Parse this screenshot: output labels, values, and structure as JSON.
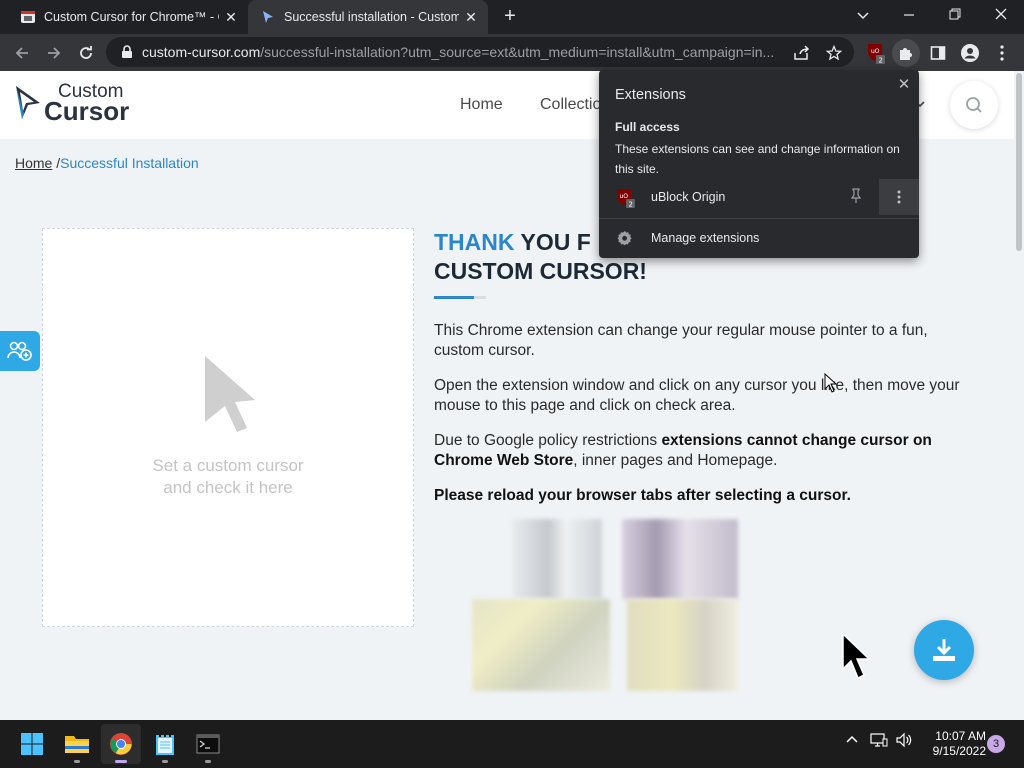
{
  "browser": {
    "tabs": [
      {
        "title": "Custom Cursor for Chrome™ - Ch",
        "active": false
      },
      {
        "title": "Successful installation - Custom C",
        "active": true
      }
    ],
    "url_host": "custom-cursor.com",
    "url_path": "/successful-installation?utm_source=ext&utm_medium=install&utm_campaign=in...",
    "extension_badge": "2"
  },
  "site": {
    "logo_line1": "Custom",
    "logo_line2": "Cursor",
    "nav": {
      "home": "Home",
      "collections": "Collectio"
    },
    "breadcrumb": {
      "home": "Home",
      "sep": "/",
      "current": "Successful Installation"
    }
  },
  "main": {
    "check_area_hint_1": "Set a custom cursor",
    "check_area_hint_2": "and check it here",
    "heading_blue": "THANK",
    "heading_rest": " YOU F",
    "heading_line2": "CUSTOM CURSOR!",
    "p1": "This Chrome extension can change your regular mouse pointer to a fun, custom cursor.",
    "p2": "Open the extension window and click on any cursor you like, then move your mouse to this page and click on check area.",
    "p3_start": "Due to Google policy restrictions ",
    "p3_bold": "extensions cannot change cursor on Chrome Web Store",
    "p3_end": ", inner pages and Homepage.",
    "p4": "Please reload your browser tabs after selecting a cursor."
  },
  "extensions_popup": {
    "title": "Extensions",
    "section": "Full access",
    "description": "These extensions can see and change information on this site.",
    "items": [
      {
        "name": "uBlock Origin",
        "badge": "2"
      }
    ],
    "manage_label": "Manage extensions"
  },
  "taskbar": {
    "time": "10:07 AM",
    "date": "9/15/2022",
    "notification_count": "3"
  },
  "colors": {
    "accent_blue": "#2b87c9",
    "cta_blue": "#2fa8e6",
    "chrome_dark": "#202124",
    "popup_bg": "#292a2d"
  }
}
